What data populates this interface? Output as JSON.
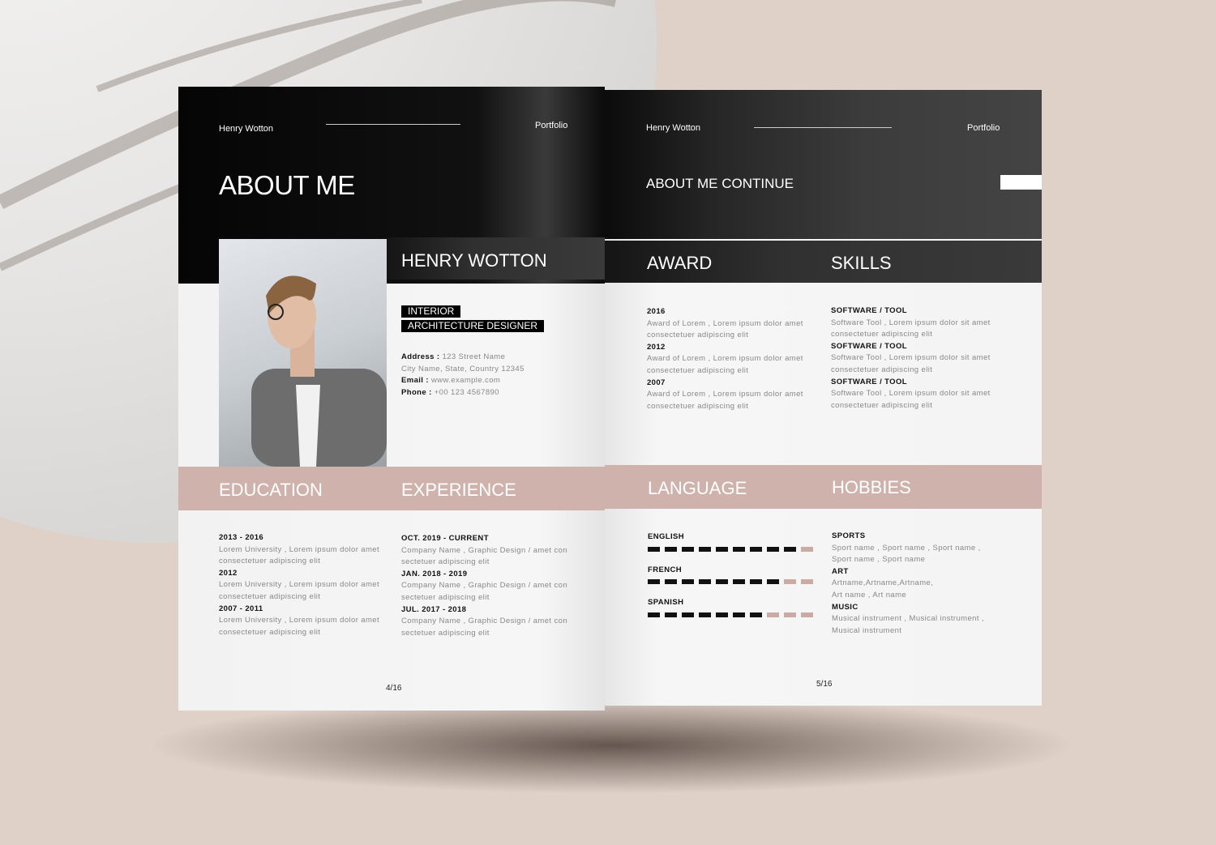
{
  "left_page": {
    "header_name": "Henry Wotton",
    "header_label": "Portfolio",
    "title": "ABOUT ME",
    "name": "HENRY WOTTON",
    "role_line1": "INTERIOR",
    "role_line2": "ARCHITECTURE DESIGNER",
    "contact": [
      {
        "label": "Address :",
        "value": "123 Street Name"
      },
      {
        "label": "",
        "value": "City Name, State, Country 12345"
      },
      {
        "label": "Email :",
        "value": "www.example.com"
      },
      {
        "label": "Phone :",
        "value": "+00 123 4567890"
      }
    ],
    "education_title": "EDUCATION",
    "experience_title": "EXPERIENCE",
    "education": [
      {
        "year": "2013 - 2016",
        "l1": "Lorem University , Lorem ipsum dolor amet",
        "l2": "consectetuer adipiscing elit"
      },
      {
        "year": "2012",
        "l1": "Lorem University , Lorem ipsum dolor amet",
        "l2": "consectetuer adipiscing elit"
      },
      {
        "year": "2007 - 2011",
        "l1": "Lorem University , Lorem ipsum dolor amet",
        "l2": "consectetuer adipiscing elit"
      }
    ],
    "experience": [
      {
        "year": "OCT. 2019 - CURRENT",
        "l1": "Company Name , Graphic Design / amet con",
        "l2": "sectetuer adipiscing elit"
      },
      {
        "year": "JAN. 2018 - 2019",
        "l1": "Company Name , Graphic Design / amet con",
        "l2": "sectetuer adipiscing elit"
      },
      {
        "year": "JUL. 2017 - 2018",
        "l1": "Company Name , Graphic Design / amet con",
        "l2": "sectetuer adipiscing elit"
      }
    ],
    "page_number": "4/16"
  },
  "right_page": {
    "header_name": "Henry Wotton",
    "header_label": "Portfolio",
    "title": "ABOUT ME CONTINUE",
    "award_title": "AWARD",
    "skills_title": "SKILLS",
    "language_title": "LANGUAGE",
    "hobbies_title": "HOBBIES",
    "awards": [
      {
        "year": "2016",
        "l1": "Award of Lorem , Lorem ipsum dolor amet",
        "l2": "consectetuer adipiscing elit"
      },
      {
        "year": "2012",
        "l1": "Award of Lorem , Lorem ipsum dolor amet",
        "l2": "consectetuer adipiscing elit"
      },
      {
        "year": "2007",
        "l1": "Award of Lorem , Lorem ipsum dolor amet",
        "l2": "consectetuer adipiscing elit"
      }
    ],
    "skills": [
      {
        "year": "SOFTWARE / TOOL",
        "l1": "Software Tool , Lorem ipsum dolor sit amet",
        "l2": "consectetuer adipiscing elit"
      },
      {
        "year": "SOFTWARE / TOOL",
        "l1": "Software Tool , Lorem ipsum dolor sit amet",
        "l2": "consectetuer adipiscing elit"
      },
      {
        "year": "SOFTWARE / TOOL",
        "l1": "Software Tool , Lorem ipsum dolor sit amet",
        "l2": "consectetuer adipiscing elit"
      }
    ],
    "languages": [
      {
        "name": "ENGLISH",
        "level": 9,
        "max": 10
      },
      {
        "name": "FRENCH",
        "level": 8,
        "max": 10
      },
      {
        "name": "SPANISH",
        "level": 7,
        "max": 10
      }
    ],
    "hobbies": [
      {
        "year": "SPORTS",
        "l1": "Sport name , Sport name , Sport name ,",
        "l2": "Sport name , Sport name"
      },
      {
        "year": "ART",
        "l1": "Artname,Artname,Artname,",
        "l2": "Art name , Art name"
      },
      {
        "year": "MUSIC",
        "l1": "Musical instrument , Musical instrument ,",
        "l2": "Musical instrument"
      }
    ],
    "page_number": "5/16"
  },
  "colors": {
    "accent_pink": "#cfb2ac",
    "dark": "#0a0a0a",
    "background": "#dfd0c8"
  }
}
